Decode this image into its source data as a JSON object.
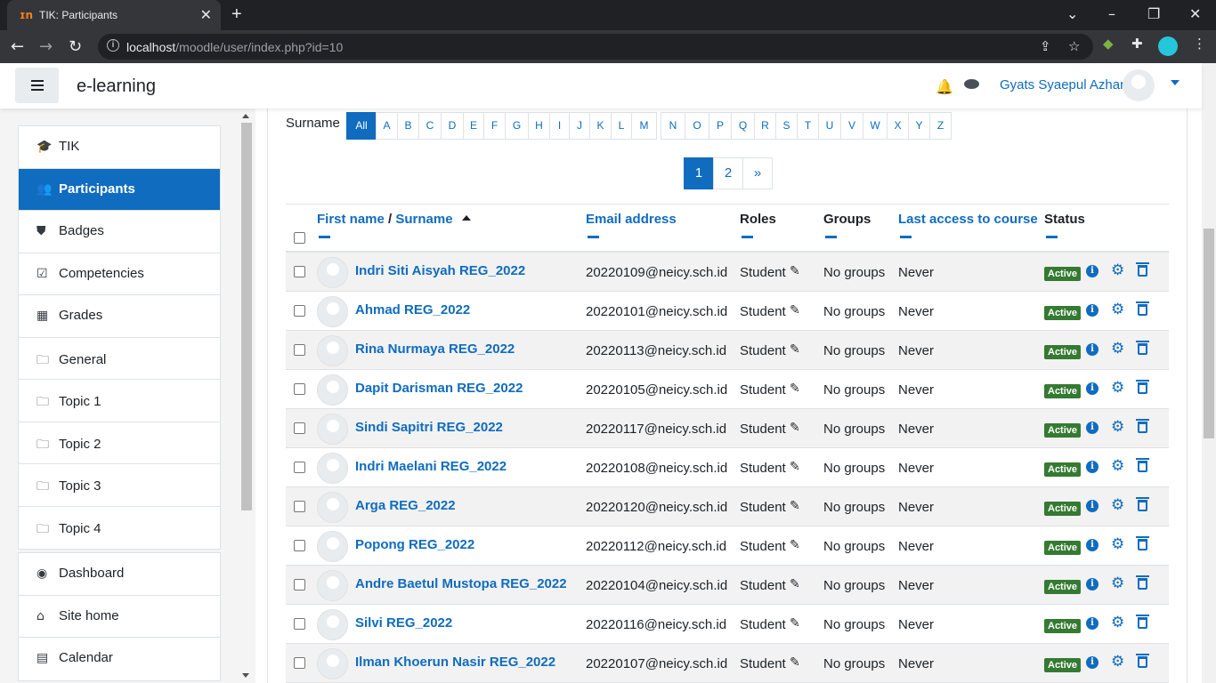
{
  "browser": {
    "tab_title": "TIK: Participants",
    "tab_favicon": "m",
    "url_host": "localhost",
    "url_path": "/moodle/user/index.php?id=10"
  },
  "navbar": {
    "brand": "e-learning",
    "user_name": "Gyats Syaepul Azhar"
  },
  "drawer": {
    "course_items": [
      {
        "label": "TIK",
        "icon": "graduation-cap-icon",
        "glyph": "🎓"
      },
      {
        "label": "Participants",
        "icon": "users-icon",
        "glyph": "👥"
      },
      {
        "label": "Badges",
        "icon": "shield-icon",
        "glyph": "⛊"
      },
      {
        "label": "Competencies",
        "icon": "check-square-icon",
        "glyph": "☑"
      },
      {
        "label": "Grades",
        "icon": "table-icon",
        "glyph": "▦"
      },
      {
        "label": "General",
        "icon": "folder-icon",
        "glyph": "🗀"
      },
      {
        "label": "Topic 1",
        "icon": "folder-icon",
        "glyph": "🗀"
      },
      {
        "label": "Topic 2",
        "icon": "folder-icon",
        "glyph": "🗀"
      },
      {
        "label": "Topic 3",
        "icon": "folder-icon",
        "glyph": "🗀"
      },
      {
        "label": "Topic 4",
        "icon": "folder-icon",
        "glyph": "🗀"
      }
    ],
    "site_items": [
      {
        "label": "Dashboard",
        "icon": "dashboard-icon",
        "glyph": "◉"
      },
      {
        "label": "Site home",
        "icon": "home-icon",
        "glyph": "⌂"
      },
      {
        "label": "Calendar",
        "icon": "calendar-icon",
        "glyph": "▤"
      }
    ],
    "active_item": "Participants"
  },
  "filter": {
    "surname_label": "Surname",
    "letters": [
      "All",
      "A",
      "B",
      "C",
      "D",
      "E",
      "F",
      "G",
      "H",
      "I",
      "J",
      "K",
      "L",
      "M",
      "N",
      "O",
      "P",
      "Q",
      "R",
      "S",
      "T",
      "U",
      "V",
      "W",
      "X",
      "Y",
      "Z"
    ],
    "active": "All"
  },
  "pagination": {
    "pages": [
      "1",
      "2",
      "»"
    ],
    "current": "1"
  },
  "table": {
    "headers": {
      "first_name": "First name",
      "separator": " / ",
      "surname": "Surname",
      "email": "Email address",
      "roles": "Roles",
      "groups": "Groups",
      "last_access": "Last access to course",
      "status": "Status"
    },
    "rows": [
      {
        "name": "Indri Siti Aisyah REG_2022",
        "email": "20220109@neicy.sch.id",
        "role": "Student",
        "groups": "No groups",
        "last_access": "Never",
        "status": "Active"
      },
      {
        "name": "Ahmad REG_2022",
        "email": "20220101@neicy.sch.id",
        "role": "Student",
        "groups": "No groups",
        "last_access": "Never",
        "status": "Active"
      },
      {
        "name": "Rina Nurmaya REG_2022",
        "email": "20220113@neicy.sch.id",
        "role": "Student",
        "groups": "No groups",
        "last_access": "Never",
        "status": "Active"
      },
      {
        "name": "Dapit Darisman REG_2022",
        "email": "20220105@neicy.sch.id",
        "role": "Student",
        "groups": "No groups",
        "last_access": "Never",
        "status": "Active"
      },
      {
        "name": "Sindi Sapitri REG_2022",
        "email": "20220117@neicy.sch.id",
        "role": "Student",
        "groups": "No groups",
        "last_access": "Never",
        "status": "Active"
      },
      {
        "name": "Indri Maelani REG_2022",
        "email": "20220108@neicy.sch.id",
        "role": "Student",
        "groups": "No groups",
        "last_access": "Never",
        "status": "Active"
      },
      {
        "name": "Arga REG_2022",
        "email": "20220120@neicy.sch.id",
        "role": "Student",
        "groups": "No groups",
        "last_access": "Never",
        "status": "Active"
      },
      {
        "name": "Popong REG_2022",
        "email": "20220112@neicy.sch.id",
        "role": "Student",
        "groups": "No groups",
        "last_access": "Never",
        "status": "Active"
      },
      {
        "name": "Andre Baetul Mustopa REG_2022",
        "email": "20220104@neicy.sch.id",
        "role": "Student",
        "groups": "No groups",
        "last_access": "Never",
        "status": "Active"
      },
      {
        "name": "Silvi REG_2022",
        "email": "20220116@neicy.sch.id",
        "role": "Student",
        "groups": "No groups",
        "last_access": "Never",
        "status": "Active"
      },
      {
        "name": "Ilman Khoerun Nasir REG_2022",
        "email": "20220107@neicy.sch.id",
        "role": "Student",
        "groups": "No groups",
        "last_access": "Never",
        "status": "Active"
      }
    ]
  },
  "colors": {
    "brand": "#0f6cbf",
    "active_badge": "#357a32",
    "browser_dark": "#202124"
  }
}
